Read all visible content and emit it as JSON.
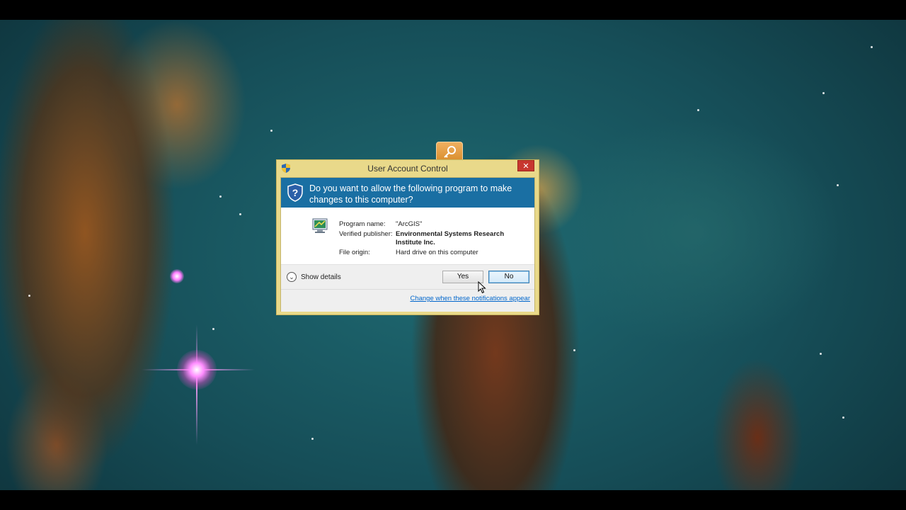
{
  "dialog": {
    "title": "User Account Control",
    "close_label": "✕",
    "question": "Do you want to allow the following program to make changes to this computer?",
    "program_name_label": "Program name:",
    "program_name_value": "\"ArcGIS\"",
    "publisher_label": "Verified publisher:",
    "publisher_value": "Environmental Systems Research Institute Inc.",
    "origin_label": "File origin:",
    "origin_value": "Hard drive on this computer",
    "show_details_label": "Show details",
    "yes_label": "Yes",
    "no_label": "No",
    "change_link": "Change when these notifications appear"
  },
  "icons": {
    "title_shield": "uac-shield-icon",
    "header_shield": "question-shield-icon",
    "program": "program-icon",
    "taskbar": "key-icon",
    "details": "chevron-down-icon"
  },
  "colors": {
    "header_bg": "#1a6fa3",
    "dialog_frame": "#e9d98a",
    "close_button": "#c7372f",
    "link": "#0066cc"
  }
}
